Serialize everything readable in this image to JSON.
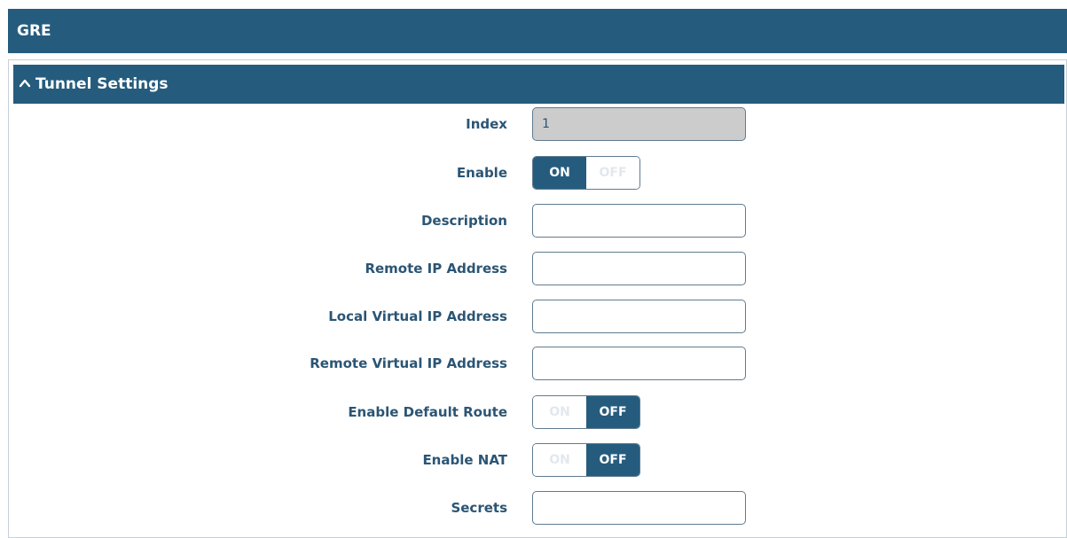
{
  "header": {
    "title": "GRE"
  },
  "section": {
    "title": "Tunnel Settings",
    "icon": "chevron-up-icon"
  },
  "fields": {
    "index": {
      "label": "Index",
      "value": "1"
    },
    "enable": {
      "label": "Enable",
      "on": "ON",
      "off": "OFF",
      "state": "on"
    },
    "description": {
      "label": "Description",
      "value": ""
    },
    "remote_ip": {
      "label": "Remote IP Address",
      "value": ""
    },
    "local_virtual_ip": {
      "label": "Local Virtual IP Address",
      "value": ""
    },
    "remote_virtual_ip": {
      "label": "Remote Virtual IP Address",
      "value": ""
    },
    "default_route": {
      "label": "Enable Default Route",
      "on": "ON",
      "off": "OFF",
      "state": "off"
    },
    "nat": {
      "label": "Enable NAT",
      "on": "ON",
      "off": "OFF",
      "state": "off"
    },
    "secrets": {
      "label": "Secrets",
      "value": ""
    }
  },
  "colors": {
    "header_bg": "#255c7e",
    "label_text": "#2b5574",
    "readonly_bg": "#cccccc"
  }
}
